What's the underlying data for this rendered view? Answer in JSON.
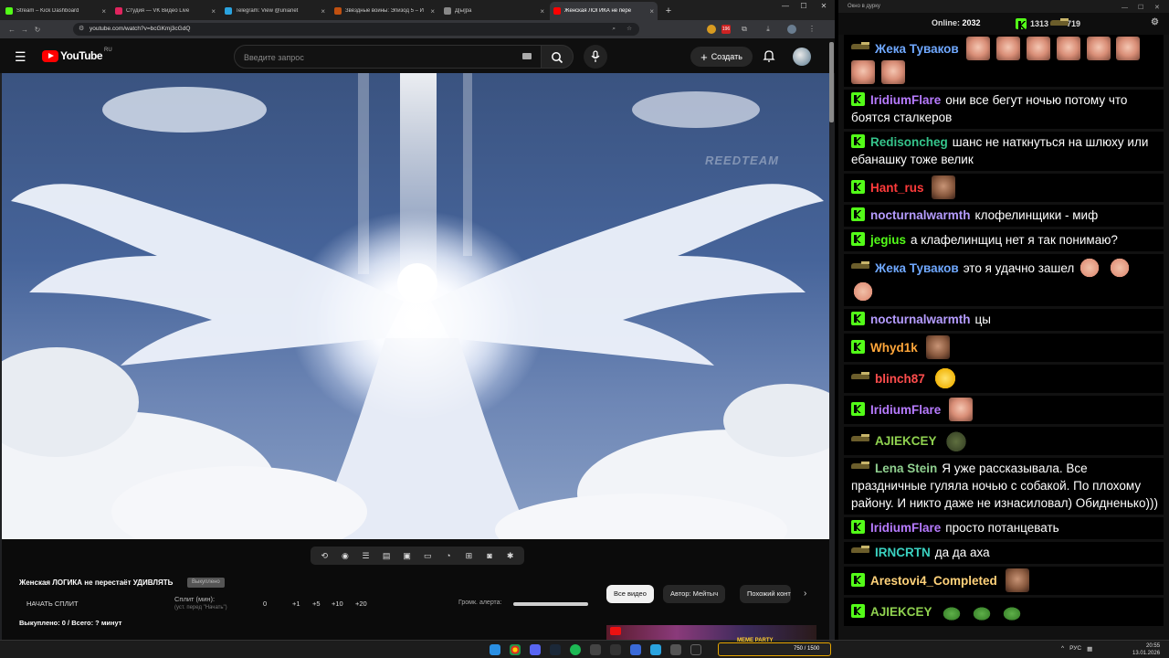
{
  "browser": {
    "tabs": [
      {
        "title": "Stream – Kick Dashboard",
        "color": "#53fc18",
        "active": false
      },
      {
        "title": "Студия — VK Видео Live",
        "color": "#e0245e",
        "active": false
      },
      {
        "title": "Telegram: View @unianet",
        "color": "#2aa3df",
        "active": false
      },
      {
        "title": "Звёздные войны: Эпизод 5 – И",
        "color": "#c05010",
        "active": false
      },
      {
        "title": "Д[ы]ра",
        "color": "#888888",
        "active": false
      },
      {
        "title": "Женская ЛОГИКА не пере",
        "color": "#ff0000",
        "active": true
      }
    ],
    "url": "youtube.com/watch?v=bcGKmj3cGdQ",
    "profile_badge": "196"
  },
  "youtube": {
    "logo_text": "YouTube",
    "region": "RU",
    "search_placeholder": "Введите запрос",
    "create_label": "Создать",
    "watermark": "REEDTEAM"
  },
  "below_video": {
    "title": "Женская ЛОГИКА не перестаёт УДИВЛЯТЬ",
    "tag_button": "Выкуплено",
    "start_split": "НАЧАТЬ СПЛИТ",
    "split_label": "Сплит (мин):",
    "split_hint": "(уст. перед \"Начать\")",
    "split_values": [
      "0",
      "+1",
      "+5",
      "+10",
      "+20"
    ],
    "alert_volume_label": "Громк. алерта:",
    "bought_text": "Выкуплено: 0 / Всего: ? минут",
    "chips": [
      "Все видео",
      "Автор: Мейтыч",
      "Похожий конт"
    ]
  },
  "chat": {
    "window_title": "Окно в дурку",
    "online_label": "Online:",
    "online_count": "2032",
    "kick_count": "1313",
    "tank_count": "719",
    "messages": [
      {
        "badge": "t",
        "user": "Жека Туваков",
        "color": "#6fa8ff",
        "text": "",
        "emotes": [
          "face",
          "face",
          "face",
          "face",
          "face",
          "face",
          "face",
          "face"
        ]
      },
      {
        "badge": "k",
        "user": "IridiumFlare",
        "color": "#b77bff",
        "text": "они все бегут ночью потому что боятся сталкеров",
        "emotes": []
      },
      {
        "badge": "k",
        "user": "Redisoncheg",
        "color": "#35c48b",
        "text": "шанс не наткнуться на шлюху или ебанашку тоже велик",
        "emotes": []
      },
      {
        "badge": "k",
        "user": "Hant_rus",
        "color": "#ff3b3b",
        "text": "",
        "emotes": [
          "face2"
        ]
      },
      {
        "badge": "k",
        "user": "nocturnalwarmth",
        "color": "#b59cff",
        "text": "клофелинщики - миф",
        "emotes": []
      },
      {
        "badge": "k",
        "user": "jegius",
        "color": "#53fc18",
        "text": "а клафелинщиц нет я так понимаю?",
        "emotes": []
      },
      {
        "badge": "t",
        "user": "Жека Туваков",
        "color": "#6fa8ff",
        "text": "это я удачно зашел",
        "emotes": [
          "bald",
          "bald",
          "bald"
        ]
      },
      {
        "badge": "k",
        "user": "nocturnalwarmth",
        "color": "#b59cff",
        "text": "цы",
        "emotes": []
      },
      {
        "badge": "k",
        "user": "Whyd1k",
        "color": "#ffa63a",
        "text": "",
        "emotes": [
          "face2"
        ]
      },
      {
        "badge": "t",
        "user": "blinch87",
        "color": "#ff4d4d",
        "text": "",
        "emotes": [
          "yellow"
        ]
      },
      {
        "badge": "k",
        "user": "IridiumFlare",
        "color": "#b77bff",
        "text": "",
        "emotes": [
          "face"
        ]
      },
      {
        "badge": "t",
        "user": "AJIEKCEY",
        "color": "#8fd14f",
        "text": "",
        "emotes": [
          "frog"
        ]
      },
      {
        "badge": "t",
        "user": "Lena Stein",
        "color": "#8fcf8f",
        "text": "Я уже рассказывала. Все праздничные гуляла ночью с собакой. По плохому району. И никто даже не изнасиловал) Обидненько)))",
        "emotes": []
      },
      {
        "badge": "k",
        "user": "IridiumFlare",
        "color": "#b77bff",
        "text": "просто потанцевать",
        "emotes": []
      },
      {
        "badge": "t",
        "user": "IRNCRTN",
        "color": "#3ad1c0",
        "text": "да да аха",
        "emotes": []
      },
      {
        "badge": "k",
        "user": "Arestovi4_Completed",
        "color": "#ffd27a",
        "text": "",
        "emotes": [
          "face2"
        ]
      },
      {
        "badge": "k",
        "user": "AJIEKCEY",
        "color": "#8fd14f",
        "text": "",
        "emotes": [
          "pepe",
          "pepe",
          "pepe"
        ]
      }
    ]
  },
  "taskbar": {
    "overlay_label": "MEME PARTY",
    "overlay_count": "750 / 1500",
    "lang": "РУС",
    "time": "20:55",
    "date": "13.01.2026"
  }
}
